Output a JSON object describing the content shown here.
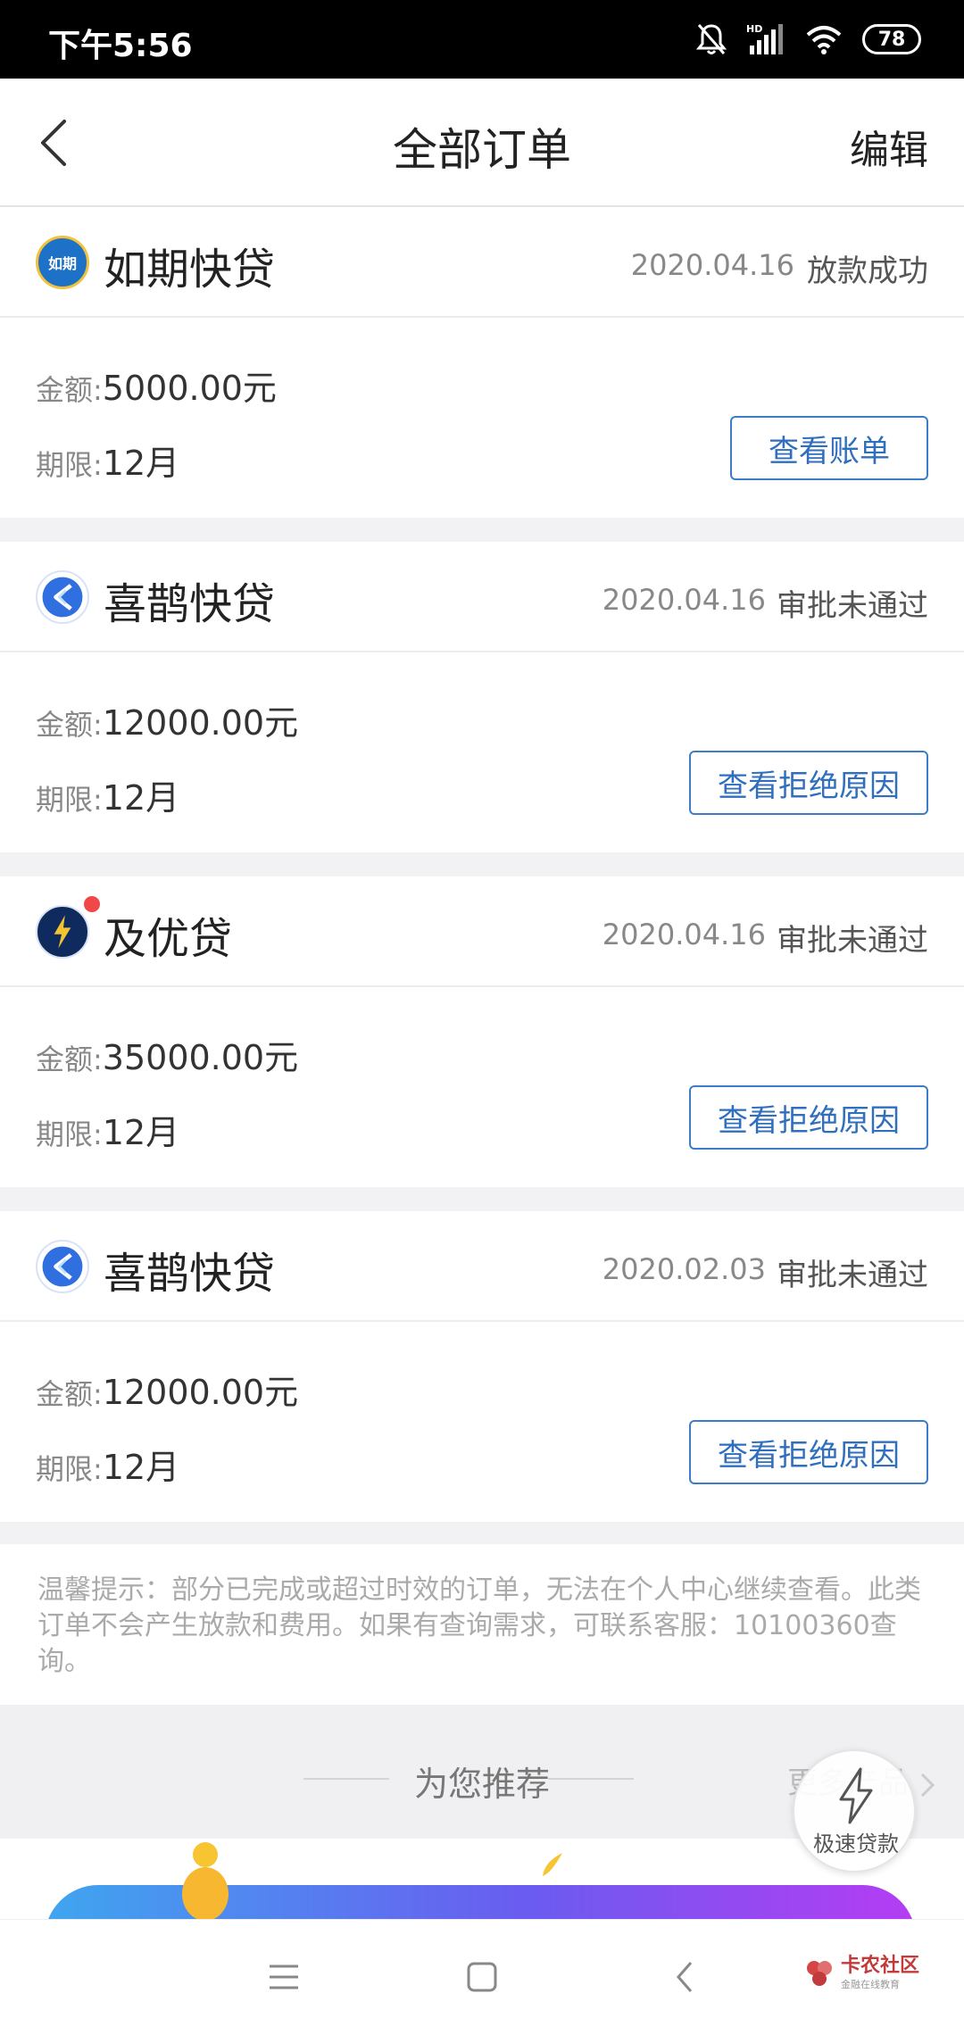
{
  "status_bar": {
    "time": "下午5:56",
    "battery": "78",
    "network_label": "HD"
  },
  "nav": {
    "title": "全部订单",
    "edit_label": "编辑"
  },
  "orders": [
    {
      "brand": "如期快贷",
      "logo_text": "如期",
      "date": "2020.04.16",
      "status": "放款成功",
      "amount_label": "金额:",
      "amount": "5000.00元",
      "term_label": "期限:",
      "term": "12月",
      "button": "查看账单"
    },
    {
      "brand": "喜鹊快贷",
      "date": "2020.04.16",
      "status": "审批未通过",
      "amount_label": "金额:",
      "amount": "12000.00元",
      "term_label": "期限:",
      "term": "12月",
      "button": "查看拒绝原因"
    },
    {
      "brand": "及优贷",
      "date": "2020.04.16",
      "status": "审批未通过",
      "amount_label": "金额:",
      "amount": "35000.00元",
      "term_label": "期限:",
      "term": "12月",
      "button": "查看拒绝原因"
    },
    {
      "brand": "喜鹊快贷",
      "date": "2020.02.03",
      "status": "审批未通过",
      "amount_label": "金额:",
      "amount": "12000.00元",
      "term_label": "期限:",
      "term": "12月",
      "button": "查看拒绝原因"
    }
  ],
  "notice": "温馨提示：部分已完成或超过时效的订单，无法在个人中心继续查看。此类订单不会产生放款和费用。如果有查询需求，可联系客服：10100360查询。",
  "recommend": {
    "title": "为您推荐",
    "more": "更多产品"
  },
  "float_button": {
    "label": "极速贷款"
  },
  "watermark": {
    "name": "卡农社区",
    "sub": "金融在线教育"
  },
  "colors": {
    "accent": "#2f6fbd",
    "status_bar": "#000000",
    "banner_start": "#3fa6ef",
    "banner_end": "#b53cf2"
  }
}
